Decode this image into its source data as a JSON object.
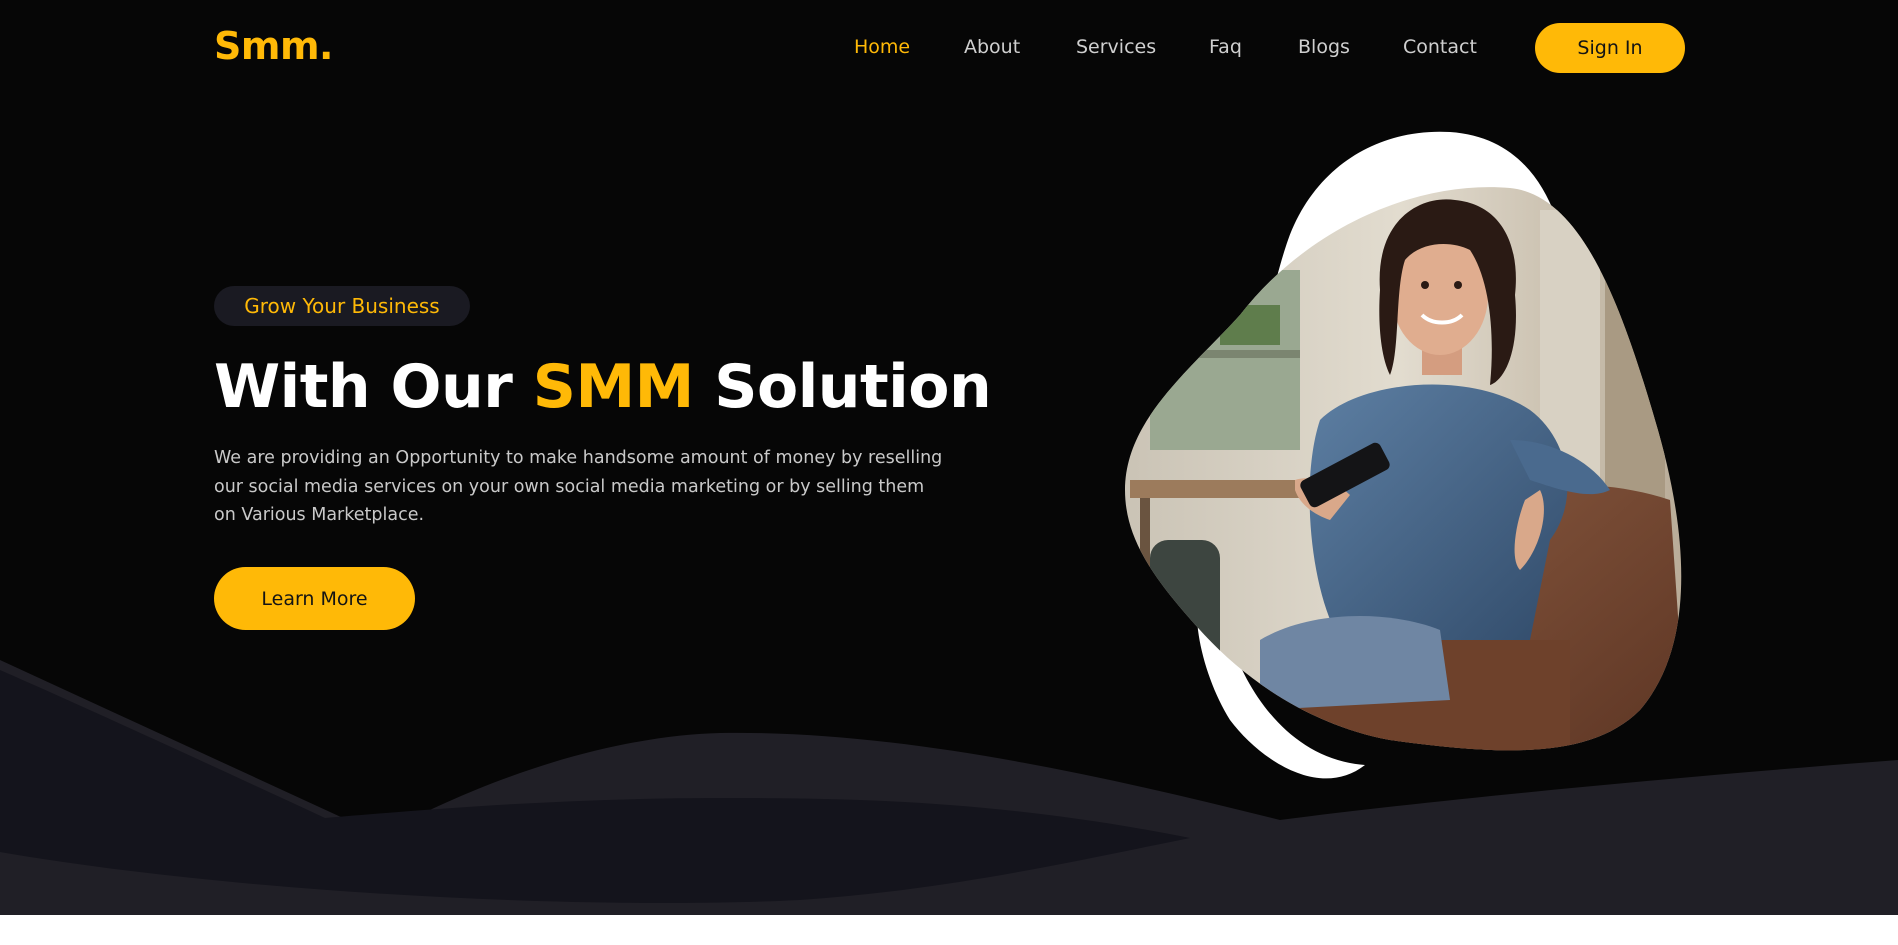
{
  "brand": {
    "logo": "Smm.",
    "accent": "#ffb907"
  },
  "nav": {
    "items": [
      {
        "label": "Home",
        "active": true
      },
      {
        "label": "About",
        "active": false
      },
      {
        "label": "Services",
        "active": false
      },
      {
        "label": "Faq",
        "active": false
      },
      {
        "label": "Blogs",
        "active": false
      },
      {
        "label": "Contact",
        "active": false
      }
    ],
    "signin_label": "Sign In"
  },
  "hero": {
    "badge": "Grow Your Business",
    "headline_before": "With Our ",
    "headline_accent": "SMM",
    "headline_after": " Solution",
    "description": "We are providing an Opportunity to make handsome amount of money by reselling our social media services on your own social media marketing or by selling them on Various Marketplace.",
    "cta_label": "Learn More"
  },
  "colors": {
    "background": "#060606",
    "accent": "#ffb907",
    "wave_light": "#201f26",
    "wave_dark": "#14141c"
  }
}
